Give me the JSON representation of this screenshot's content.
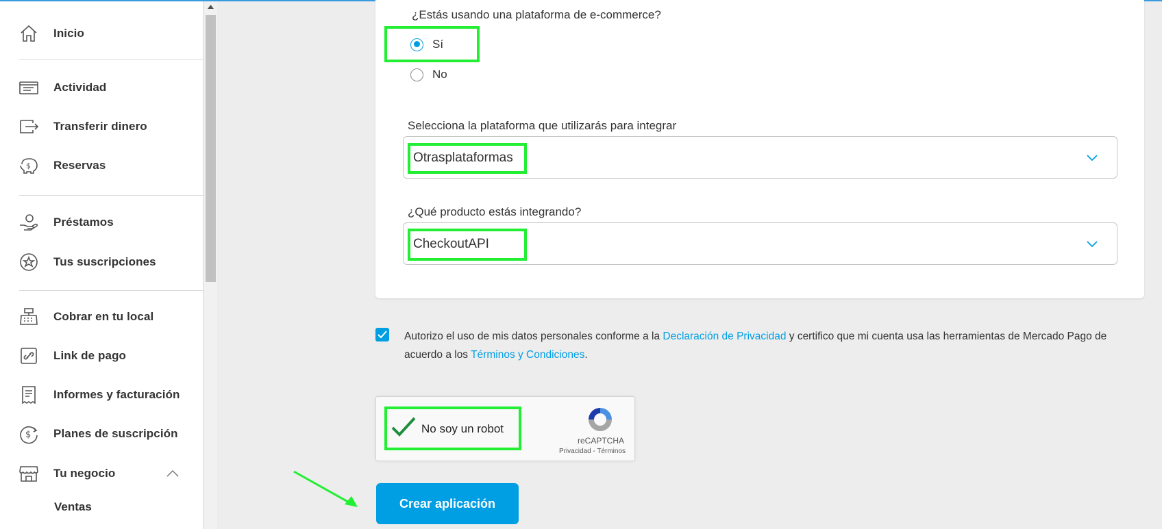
{
  "sidebar": {
    "items": [
      {
        "label": "Inicio",
        "icon": "home-icon"
      },
      {
        "label": "Actividad",
        "icon": "activity-icon"
      },
      {
        "label": "Transferir dinero",
        "icon": "transfer-icon"
      },
      {
        "label": "Reservas",
        "icon": "piggy-bank-icon"
      },
      {
        "label": "Préstamos",
        "icon": "loan-hand-icon"
      },
      {
        "label": "Tus suscripciones",
        "icon": "star-badge-icon"
      },
      {
        "label": "Cobrar en tu local",
        "icon": "cash-register-icon"
      },
      {
        "label": "Link de pago",
        "icon": "payment-link-icon"
      },
      {
        "label": "Informes y facturación",
        "icon": "receipt-icon"
      },
      {
        "label": "Planes de suscripción",
        "icon": "subscription-plan-icon"
      },
      {
        "label": "Tu negocio",
        "icon": "store-icon"
      }
    ],
    "sub_item": "Ventas"
  },
  "form": {
    "ecommerce_question": "¿Estás usando una plataforma de e-commerce?",
    "radio_yes": "Sí",
    "radio_no": "No",
    "radio_selected": "Sí",
    "platform_label": "Selecciona la plataforma que utilizarás para integrar",
    "platform_value": "Otrasplataformas",
    "product_label": "¿Qué producto estás integrando?",
    "product_value": "CheckoutAPI"
  },
  "consent": {
    "checked": true,
    "text_1": "Autorizo el uso de mis datos personales conforme a la ",
    "link_privacy": "Declaración de Privacidad",
    "text_2": " y certifico que mi cuenta usa las herramientas de Mercado Pago de acuerdo a los ",
    "link_terms": "Términos y Condiciones",
    "text_3": "."
  },
  "recaptcha": {
    "label": "No soy un robot",
    "brand": "reCAPTCHA",
    "links": "Privacidad - Términos",
    "verified": true
  },
  "submit_label": "Crear aplicación",
  "colors": {
    "accent": "#009ee3",
    "highlight": "#22ee33",
    "background": "#ededed"
  }
}
